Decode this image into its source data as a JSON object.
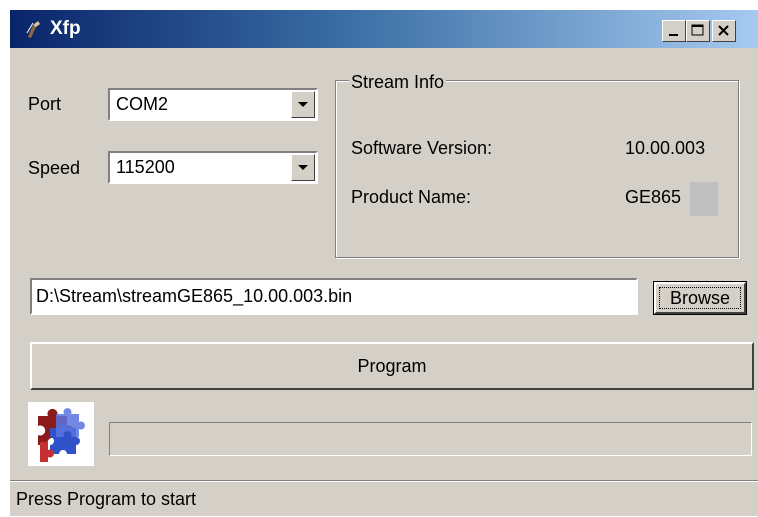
{
  "window": {
    "title": "Xfp"
  },
  "titlebar_buttons": {
    "minimize": "minimize-icon",
    "maximize": "maximize-icon",
    "close": "close-icon"
  },
  "port": {
    "label": "Port",
    "value": "COM2"
  },
  "speed": {
    "label": "Speed",
    "value": "115200"
  },
  "stream_info": {
    "title": "Stream Info",
    "software_version_label": "Software Version:",
    "software_version_value": "10.00.003",
    "product_name_label": "Product Name:",
    "product_name_value": "GE865"
  },
  "file_path": "D:\\Stream\\streamGE865_10.00.003.bin",
  "browse_label": "Browse",
  "program_label": "Program",
  "progress": {
    "fraction": 0
  },
  "status_text": "Press Program to start"
}
